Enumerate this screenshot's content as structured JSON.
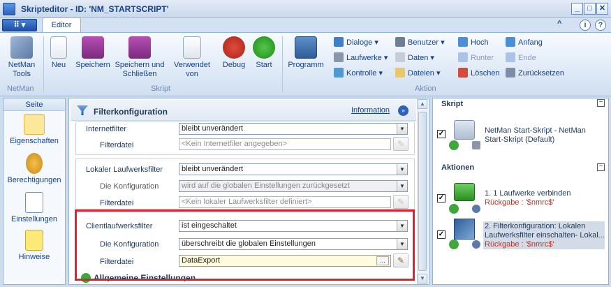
{
  "window": {
    "title": "Skripteditor - ID: 'NM_STARTSCRIPT'",
    "minimize": "_",
    "maximize": "□",
    "close": "✕"
  },
  "tabs": {
    "file_menu": "▾",
    "editor": "Editor"
  },
  "top_icons": {
    "up": "^",
    "info": "i",
    "help": "?"
  },
  "ribbon": {
    "netman_tools": "NetMan Tools",
    "group_netman": "NetMan",
    "neu": "Neu",
    "speichern": "Speichern",
    "speichern_schliessen": "Speichern und Schließen",
    "verwendet_von": "Verwendet von",
    "debug": "Debug",
    "start": "Start",
    "group_skript": "Skript",
    "programm": "Programm",
    "dialoge": "Dialoge",
    "laufwerke": "Laufwerke",
    "kontrolle": "Kontrolle",
    "benutzer": "Benutzer",
    "daten": "Daten",
    "dateien": "Dateien",
    "hoch": "Hoch",
    "runter": "Runter",
    "loeschen": "Löschen",
    "anfang": "Anfang",
    "ende": "Ende",
    "zuruecksetzen": "Zurücksetzen",
    "group_aktion": "Aktion"
  },
  "left_panel": {
    "header": "Seite",
    "items": [
      {
        "label": "Eigenschaften"
      },
      {
        "label": "Berechtigungen"
      },
      {
        "label": "Einstellungen"
      },
      {
        "label": "Hinweise"
      }
    ]
  },
  "filter": {
    "title": "Filterkonfiguration",
    "info_link": "Information",
    "internetfilter_label": "Internetfilter",
    "internetfilter_value": "bleibt unverändert",
    "filterdatei1_label": "Filterdatei",
    "filterdatei1_placeholder": "<Kein Internetfiler angegeben>",
    "lokal_label": "Lokaler Laufwerksfilter",
    "lokal_value": "bleibt unverändert",
    "konfig1_label": "Die Konfiguration",
    "konfig1_value": "wird auf die globalen Einstellungen zurückgesetzt",
    "filterdatei2_label": "Filterdatei",
    "filterdatei2_placeholder": "<Kein lokaler Laufwerksfilter definiert>",
    "client_label": "Clientlaufwerksfilter",
    "client_value": "ist eingeschaltet",
    "konfig2_label": "Die Konfiguration",
    "konfig2_value": "überschreibt die globalen Einstellungen",
    "filterdatei3_label": "Filterdatei",
    "filterdatei3_value": "DataExport",
    "browse": "...",
    "next_section": "Allgemeine Einstellungen"
  },
  "right_panel": {
    "skript_header": "Skript",
    "skript_text": "NetMan Start-Skript - NetMan Start-Skript (Default)",
    "aktionen_header": "Aktionen",
    "actions": [
      {
        "text": "1. 1 Laufwerke verbinden",
        "ret": "Rückgabe : '$nmrc$'"
      },
      {
        "text": "2. Filterkonfiguration: Lokalen Laufwerksfilter einschalten- Lokal...",
        "ret": "Rückgabe : '$nmrc$'"
      }
    ],
    "collapse": "−"
  },
  "icons": {
    "check": "✓",
    "arrow": "▼",
    "pencil": "✎",
    "chevron": "»"
  }
}
